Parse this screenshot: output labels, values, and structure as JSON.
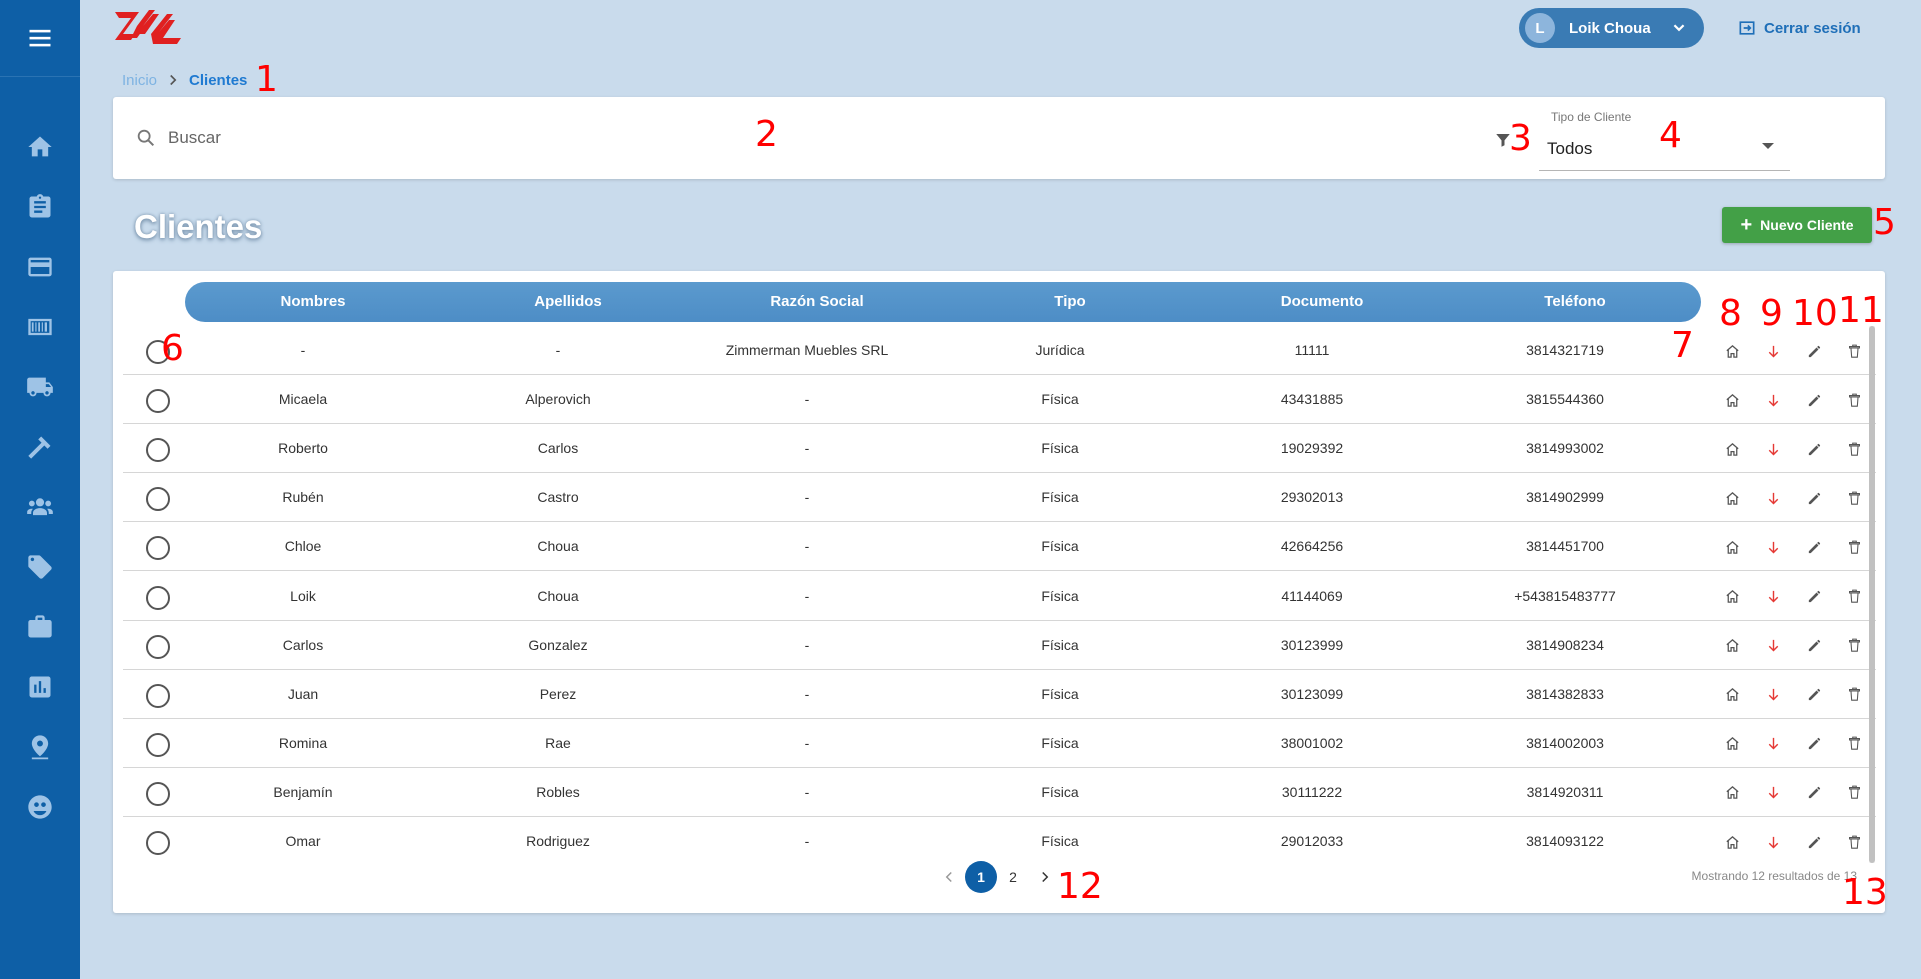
{
  "header": {
    "user": {
      "initial": "L",
      "name": "Loik Choua"
    },
    "logout_label": "Cerrar sesión"
  },
  "sidebar": {
    "items": [
      {
        "icon": "home-icon"
      },
      {
        "icon": "clipboard-icon"
      },
      {
        "icon": "credit-card-icon"
      },
      {
        "icon": "barcode-icon"
      },
      {
        "icon": "truck-icon"
      },
      {
        "icon": "hammer-icon"
      },
      {
        "icon": "users-icon"
      },
      {
        "icon": "tag-icon"
      },
      {
        "icon": "briefcase-icon"
      },
      {
        "icon": "chart-icon"
      },
      {
        "icon": "location-icon"
      },
      {
        "icon": "face-icon"
      }
    ]
  },
  "breadcrumb": {
    "home": "Inicio",
    "current": "Clientes"
  },
  "search": {
    "placeholder": "Buscar"
  },
  "filter": {
    "label": "Tipo de Cliente",
    "value": "Todos"
  },
  "page": {
    "title": "Clientes",
    "new_button": "Nuevo Cliente"
  },
  "table": {
    "headers": [
      "Nombres",
      "Apellidos",
      "Razón Social",
      "Tipo",
      "Documento",
      "Teléfono"
    ],
    "rows": [
      [
        "-",
        "-",
        "Zimmerman Muebles SRL",
        "Jurídica",
        "11111",
        "3814321719"
      ],
      [
        "Micaela",
        "Alperovich",
        "-",
        "Física",
        "43431885",
        "3815544360"
      ],
      [
        "Roberto",
        "Carlos",
        "-",
        "Física",
        "19029392",
        "3814993002"
      ],
      [
        "Rubén",
        "Castro",
        "-",
        "Física",
        "29302013",
        "3814902999"
      ],
      [
        "Chloe",
        "Choua",
        "-",
        "Física",
        "42664256",
        "3814451700"
      ],
      [
        "Loik",
        "Choua",
        "-",
        "Física",
        "41144069",
        "+543815483777"
      ],
      [
        "Carlos",
        "Gonzalez",
        "-",
        "Física",
        "30123999",
        "3814908234"
      ],
      [
        "Juan",
        "Perez",
        "-",
        "Física",
        "30123099",
        "3814382833"
      ],
      [
        "Romina",
        "Rae",
        "-",
        "Física",
        "38001002",
        "3814002003"
      ],
      [
        "Benjamín",
        "Robles",
        "-",
        "Física",
        "30111222",
        "3814920311"
      ],
      [
        "Omar",
        "Rodriguez",
        "-",
        "Física",
        "29012033",
        "3814093122"
      ]
    ]
  },
  "pagination": {
    "pages": [
      "1",
      "2"
    ],
    "current": "1",
    "summary": "Mostrando 12 resultados de 13"
  },
  "annotations": [
    "1",
    "2",
    "3",
    "4",
    "5",
    "6",
    "7",
    "8",
    "9",
    "10",
    "11",
    "12",
    "13"
  ],
  "colors": {
    "sidebar": "#0e5fa6",
    "accent": "#1f7ad1",
    "header_row": "#4d8dc6",
    "new_button": "#43a047",
    "down_arrow": "#e53935"
  }
}
